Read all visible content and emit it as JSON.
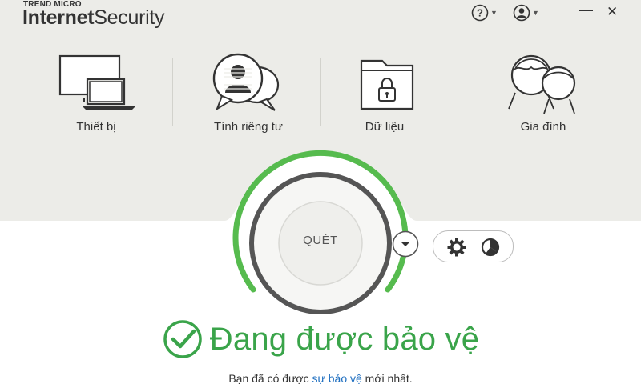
{
  "app": {
    "vendor": "TREND MICRO",
    "name_bold": "Internet",
    "name_regular": "Security"
  },
  "titlebar": {
    "help_icon": "question-circle-icon",
    "account_icon": "user-circle-icon",
    "minimize": "—",
    "close": "✕"
  },
  "nav": [
    {
      "label": "Thiết bị",
      "icon": "devices-icon"
    },
    {
      "label": "Tính riêng tư",
      "icon": "privacy-icon"
    },
    {
      "label": "Dữ liệu",
      "icon": "data-lock-icon"
    },
    {
      "label": "Gia đình",
      "icon": "family-icon"
    }
  ],
  "scan": {
    "label": "QUÉT",
    "progress_fraction": 0.75
  },
  "status": {
    "title": "Đang được bảo vệ",
    "sub_before": "Bạn đã có được ",
    "sub_link": "sự bảo vệ",
    "sub_after": " mới nhất."
  },
  "colors": {
    "accent_green": "#3aa44a",
    "link_blue": "#1f6fc0",
    "top_bg": "#ecece8"
  }
}
